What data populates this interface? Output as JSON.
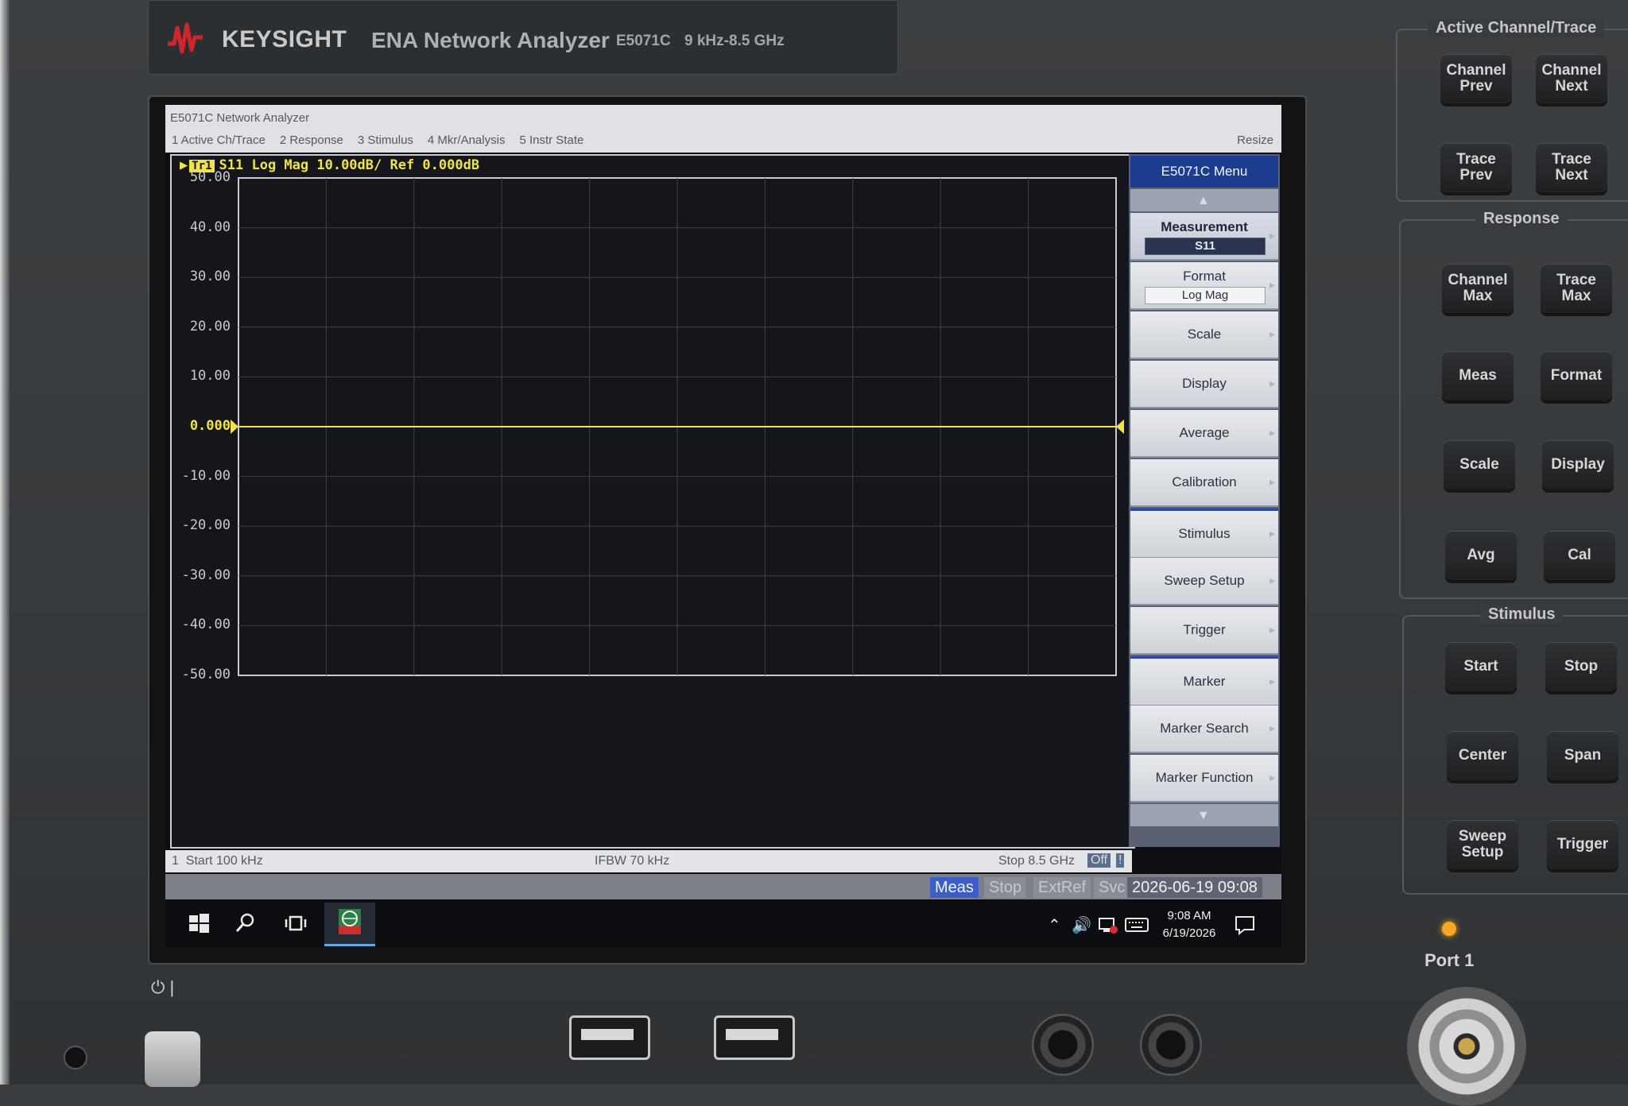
{
  "instrument": {
    "brand": "KEYSIGHT",
    "product": "ENA Network Analyzer",
    "model": "E5071C",
    "range": "9 kHz-8.5 GHz",
    "brand_color": "#d0262b"
  },
  "window": {
    "title": "E5071C Network Analyzer",
    "menu": [
      "1 Active Ch/Trace",
      "2 Response",
      "3 Stimulus",
      "4 Mkr/Analysis",
      "5 Instr State"
    ],
    "resize": "Resize"
  },
  "trace": {
    "badge": "Tr1",
    "header": "S11 Log Mag 10.00dB/ Ref 0.000dB",
    "color": "#f0e34a"
  },
  "chart_data": {
    "type": "line",
    "y_ticks": [
      "50.00",
      "40.00",
      "30.00",
      "20.00",
      "10.00",
      "0.000",
      "-10.00",
      "-20.00",
      "-30.00",
      "-40.00",
      "-50.00"
    ],
    "ylim": [
      -50,
      50
    ],
    "x_divisions": 10,
    "grid": true,
    "series": [
      {
        "x": [
          0.0001,
          8.5
        ],
        "y": [
          0,
          0
        ]
      }
    ]
  },
  "status": {
    "channel": "1",
    "start": "Start 100 kHz",
    "ifbw": "IFBW 70 kHz",
    "stop": "Stop 8.5 GHz",
    "off": "Off",
    "bang": "!"
  },
  "bottom": {
    "meas": "Meas",
    "stop": "Stop",
    "extref": "ExtRef",
    "svc": "Svc",
    "datetime": "2026-06-19 09:08"
  },
  "softmenu": {
    "title": "E5071C Menu",
    "up_glyph": "▲",
    "down_glyph": "▼",
    "measurement": {
      "label": "Measurement",
      "value": "S11"
    },
    "format": {
      "label": "Format",
      "value": "Log Mag"
    },
    "items": [
      "Scale",
      "Display",
      "Average",
      "Calibration",
      "Stimulus",
      "Sweep Setup",
      "Trigger",
      "Marker",
      "Marker Search",
      "Marker Function"
    ]
  },
  "taskbar": {
    "time": "9:08 AM",
    "date": "6/19/2026"
  },
  "hardware": {
    "active_group": "Active Channel/Trace",
    "active_keys": [
      "Channel\nPrev",
      "Channel\nNext",
      "Trace\nPrev",
      "Trace\nNext"
    ],
    "response_group": "Response",
    "response_keys": [
      "Channel\nMax",
      "Trace\nMax",
      "Meas",
      "Format",
      "Scale",
      "Display",
      "Avg",
      "Cal"
    ],
    "stimulus_group": "Stimulus",
    "stimulus_keys": [
      "Start",
      "Stop",
      "Center",
      "Span",
      "Sweep\nSetup",
      "Trigger"
    ],
    "port_label": "Port 1"
  }
}
